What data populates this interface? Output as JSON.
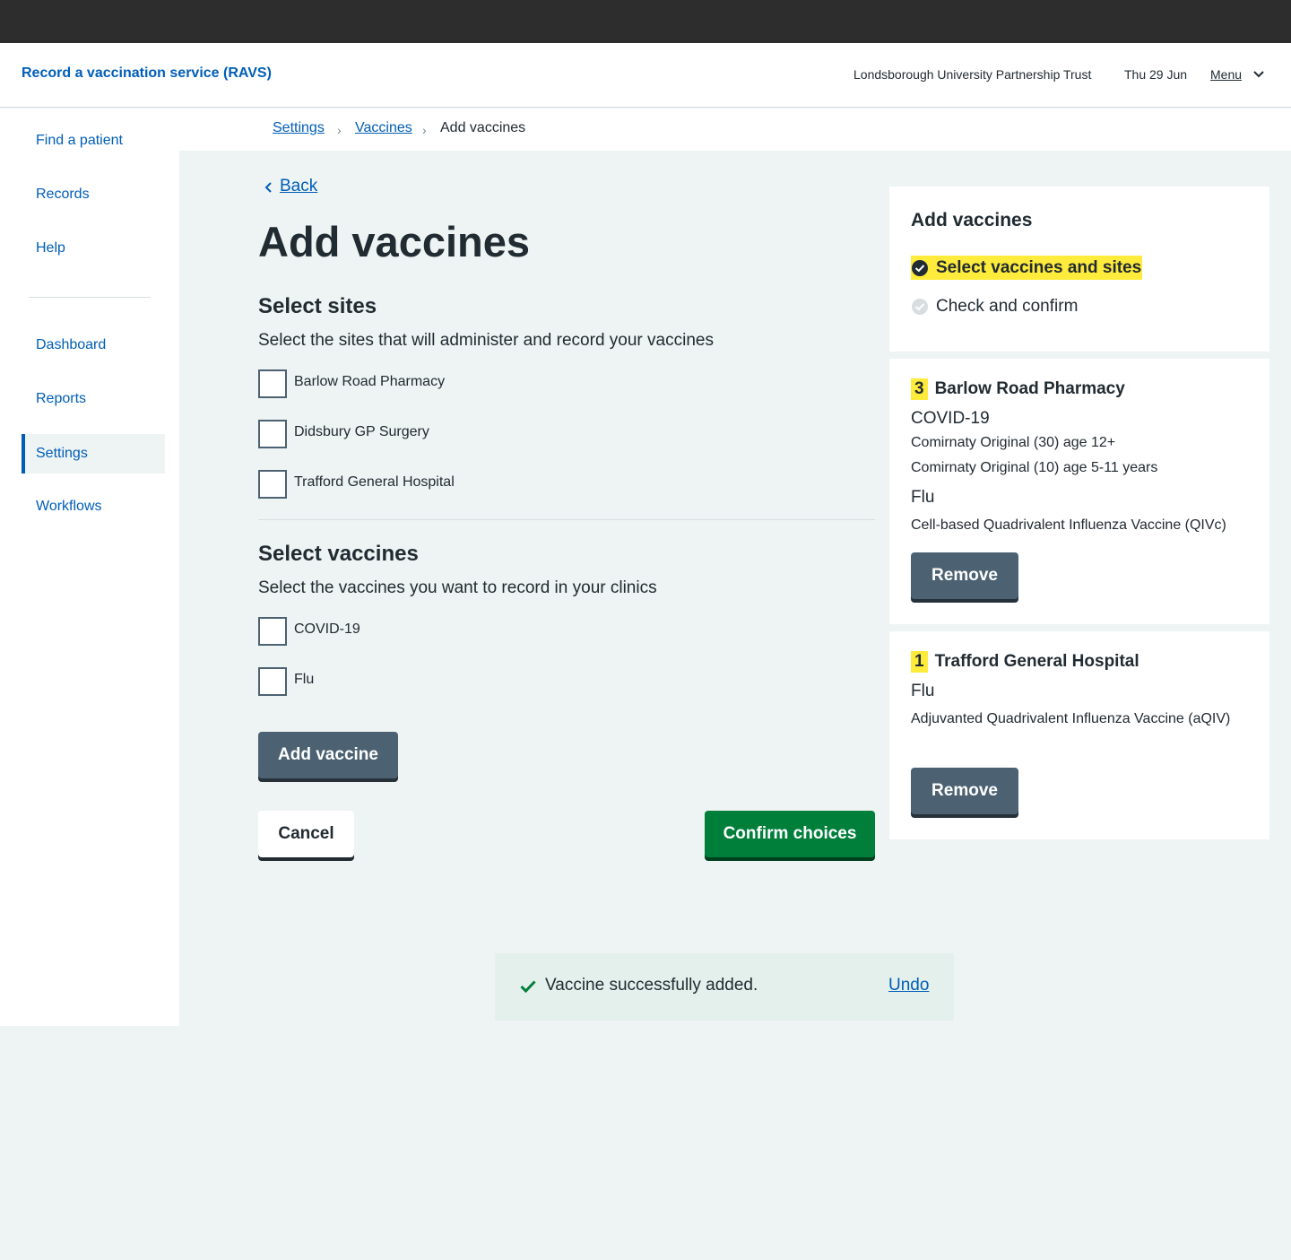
{
  "header": {
    "service_name": "Record a vaccination service (RAVS)",
    "organisation": "Londsborough University Partnership Trust",
    "date": "Thu 29 Jun",
    "menu_label": "Menu"
  },
  "sidebar": {
    "items": [
      {
        "label": "Find a patient"
      },
      {
        "label": "Records"
      },
      {
        "label": "Help"
      },
      {
        "label": "Dashboard"
      },
      {
        "label": "Reports"
      },
      {
        "label": "Settings",
        "active": true
      },
      {
        "label": "Workflows"
      }
    ]
  },
  "breadcrumb": {
    "items": [
      "Settings",
      "Vaccines",
      "Add vaccines"
    ]
  },
  "back_label": "Back",
  "page_title": "Add vaccines",
  "sites_section": {
    "heading": "Select sites",
    "hint": "Select the sites that will administer and record your vaccines",
    "options": [
      "Barlow Road Pharmacy",
      "Didsbury GP Surgery",
      "Trafford General Hospital"
    ]
  },
  "vaccines_section": {
    "heading": "Select vaccines",
    "hint": "Select the vaccines you want to record in your clinics",
    "options": [
      "COVID-19",
      "Flu"
    ]
  },
  "buttons": {
    "add_vaccine": "Add vaccine",
    "cancel": "Cancel",
    "confirm": "Confirm choices"
  },
  "progress_card": {
    "title": "Add vaccines",
    "steps": [
      {
        "label": "Select vaccines and sites",
        "state": "current"
      },
      {
        "label": "Check and confirm",
        "state": "todo"
      }
    ]
  },
  "site_cards": [
    {
      "count": "3",
      "site": "Barlow Road Pharmacy",
      "groups": [
        {
          "vaccine": "COVID-19",
          "products": [
            "Comirnaty Original (30) age 12+",
            "Comirnaty Original (10) age 5-11 years"
          ]
        },
        {
          "vaccine": "Flu",
          "products": [
            "Cell-based Quadrivalent Influenza Vaccine (QIVc)"
          ]
        }
      ],
      "remove_label": "Remove"
    },
    {
      "count": "1",
      "site": "Trafford General Hospital",
      "groups": [
        {
          "vaccine": "Flu",
          "products": [
            "Adjuvanted Quadrivalent Influenza Vaccine (aQIV)"
          ]
        }
      ],
      "remove_label": "Remove"
    }
  ],
  "toast": {
    "message": "Vaccine successfully added.",
    "undo_label": "Undo"
  },
  "colors": {
    "link": "#005eb8",
    "primary_button": "#007f3b",
    "secondary_button": "#4c6272",
    "highlight": "#ffeb3b",
    "page_background": "#eef3f3",
    "toast_background": "#e4f0eb"
  }
}
